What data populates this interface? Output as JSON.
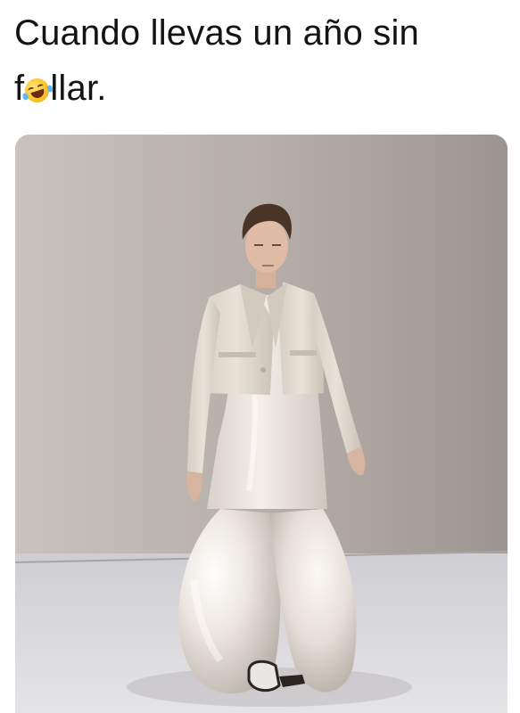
{
  "caption": {
    "line1": "Cuando llevas un año sin",
    "line2_prefix": "f",
    "line2_suffix": "llar."
  },
  "icons": {
    "emoji": "rolling-on-the-floor-laughing-emoji"
  },
  "colors": {
    "text": "#141414",
    "wall": "#bdb7b2",
    "floor": "#d9d8db",
    "garment": "#ece6df",
    "jacket": "#e4ddd1"
  }
}
